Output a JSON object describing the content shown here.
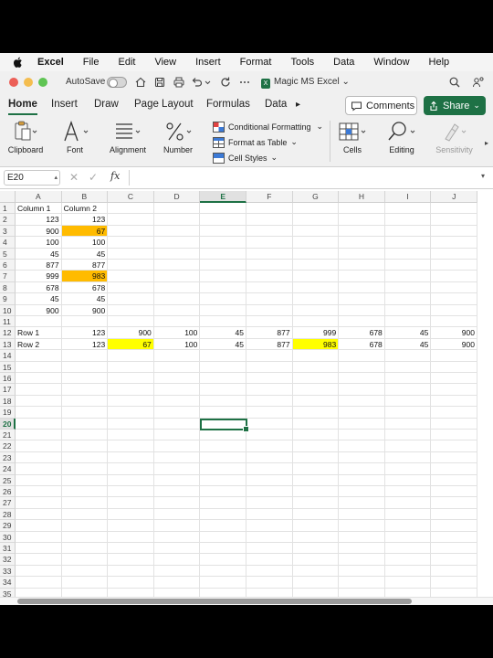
{
  "menubar": {
    "items": [
      {
        "label": "Excel",
        "bold": true
      },
      {
        "label": "File"
      },
      {
        "label": "Edit"
      },
      {
        "label": "View"
      },
      {
        "label": "Insert"
      },
      {
        "label": "Format"
      },
      {
        "label": "Tools"
      },
      {
        "label": "Data"
      },
      {
        "label": "Window"
      },
      {
        "label": "Help"
      }
    ]
  },
  "titlebar": {
    "autosave_label": "AutoSave",
    "autosave_on": false,
    "doc_title": "Magic MS Excel"
  },
  "ribbon_tabs": [
    "Home",
    "Insert",
    "Draw",
    "Page Layout",
    "Formulas",
    "Data"
  ],
  "active_tab": "Home",
  "buttons": {
    "comments": "Comments",
    "share": "Share"
  },
  "ribbon": {
    "clipboard": "Clipboard",
    "font": "Font",
    "alignment": "Alignment",
    "number": "Number",
    "conditional_formatting": "Conditional Formatting",
    "format_as_table": "Format as Table",
    "cell_styles": "Cell Styles",
    "cells": "Cells",
    "editing": "Editing",
    "sensitivity": "Sensitivity"
  },
  "formula_bar": {
    "name_box": "E20",
    "fx": "fx",
    "value": ""
  },
  "sheet": {
    "columns": [
      "A",
      "B",
      "C",
      "D",
      "E",
      "F",
      "G",
      "H",
      "I",
      "J"
    ],
    "selected_column": "E",
    "selected_row": 20,
    "row_count": 35,
    "cells": [
      {
        "r": 1,
        "c": "A",
        "v": "Column 1"
      },
      {
        "r": 1,
        "c": "B",
        "v": "Column 2"
      },
      {
        "r": 2,
        "c": "A",
        "v": "123",
        "num": true
      },
      {
        "r": 2,
        "c": "B",
        "v": "123",
        "num": true
      },
      {
        "r": 3,
        "c": "A",
        "v": "900",
        "num": true
      },
      {
        "r": 3,
        "c": "B",
        "v": "67",
        "num": true,
        "fill": "orange"
      },
      {
        "r": 4,
        "c": "A",
        "v": "100",
        "num": true
      },
      {
        "r": 4,
        "c": "B",
        "v": "100",
        "num": true
      },
      {
        "r": 5,
        "c": "A",
        "v": "45",
        "num": true
      },
      {
        "r": 5,
        "c": "B",
        "v": "45",
        "num": true
      },
      {
        "r": 6,
        "c": "A",
        "v": "877",
        "num": true
      },
      {
        "r": 6,
        "c": "B",
        "v": "877",
        "num": true
      },
      {
        "r": 7,
        "c": "A",
        "v": "999",
        "num": true
      },
      {
        "r": 7,
        "c": "B",
        "v": "983",
        "num": true,
        "fill": "orange"
      },
      {
        "r": 8,
        "c": "A",
        "v": "678",
        "num": true
      },
      {
        "r": 8,
        "c": "B",
        "v": "678",
        "num": true
      },
      {
        "r": 9,
        "c": "A",
        "v": "45",
        "num": true
      },
      {
        "r": 9,
        "c": "B",
        "v": "45",
        "num": true
      },
      {
        "r": 10,
        "c": "A",
        "v": "900",
        "num": true
      },
      {
        "r": 10,
        "c": "B",
        "v": "900",
        "num": true
      },
      {
        "r": 12,
        "c": "A",
        "v": "Row 1"
      },
      {
        "r": 12,
        "c": "B",
        "v": "123",
        "num": true
      },
      {
        "r": 12,
        "c": "C",
        "v": "900",
        "num": true
      },
      {
        "r": 12,
        "c": "D",
        "v": "100",
        "num": true
      },
      {
        "r": 12,
        "c": "E",
        "v": "45",
        "num": true
      },
      {
        "r": 12,
        "c": "F",
        "v": "877",
        "num": true
      },
      {
        "r": 12,
        "c": "G",
        "v": "999",
        "num": true
      },
      {
        "r": 12,
        "c": "H",
        "v": "678",
        "num": true
      },
      {
        "r": 12,
        "c": "I",
        "v": "45",
        "num": true
      },
      {
        "r": 12,
        "c": "J",
        "v": "900",
        "num": true
      },
      {
        "r": 13,
        "c": "A",
        "v": "Row 2"
      },
      {
        "r": 13,
        "c": "B",
        "v": "123",
        "num": true
      },
      {
        "r": 13,
        "c": "C",
        "v": "67",
        "num": true,
        "fill": "yellow"
      },
      {
        "r": 13,
        "c": "D",
        "v": "100",
        "num": true
      },
      {
        "r": 13,
        "c": "E",
        "v": "45",
        "num": true
      },
      {
        "r": 13,
        "c": "F",
        "v": "877",
        "num": true
      },
      {
        "r": 13,
        "c": "G",
        "v": "983",
        "num": true,
        "fill": "yellow"
      },
      {
        "r": 13,
        "c": "H",
        "v": "678",
        "num": true
      },
      {
        "r": 13,
        "c": "I",
        "v": "45",
        "num": true
      },
      {
        "r": 13,
        "c": "J",
        "v": "900",
        "num": true
      }
    ]
  },
  "colors": {
    "excel_green": "#1e7145",
    "orange_fill": "#ffbb00",
    "yellow_fill": "#ffff00"
  }
}
